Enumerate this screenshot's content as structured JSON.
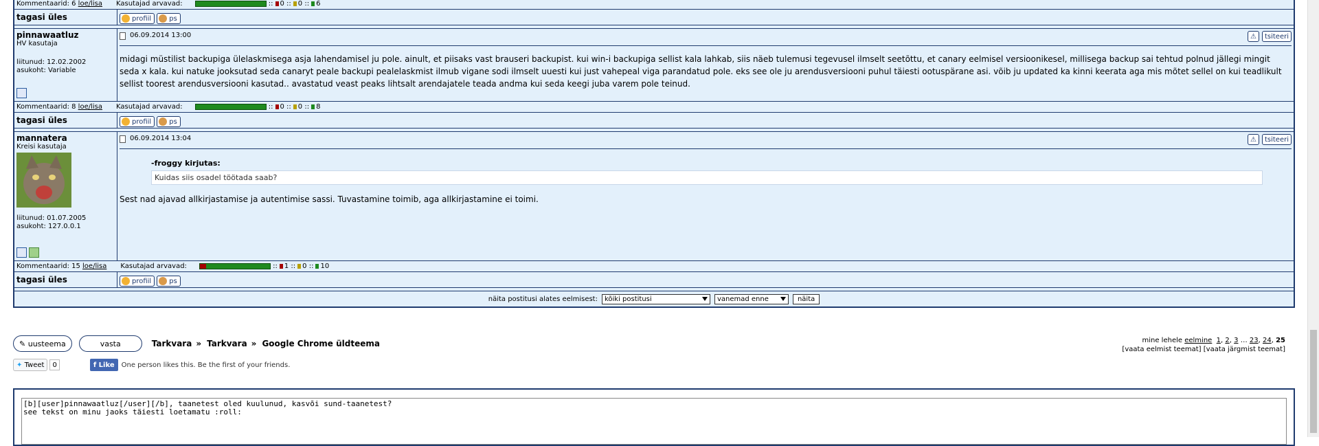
{
  "post1_meta": {
    "comments": "Kommentaarid: 6",
    "readlink": "loe/lisa",
    "users_label": "Kasutajad arvavad:",
    "neg": "0",
    "neutral": "0",
    "pos": "6"
  },
  "back_to_top": "tagasi üles",
  "buttons": {
    "profile": "profiil",
    "pm": "ps",
    "quote": "tsiteeri"
  },
  "post2": {
    "user": "pinnawaatluz",
    "title": "HV kasutaja",
    "joined": "liitunud: 12.02.2002",
    "location": "asukoht: Variable",
    "date": "06.09.2014 13:00",
    "text": "midagi müstilist backupiga ülelaskmisega asja lahendamisel ju pole. ainult, et piisaks vast brauseri backupist. kui win-i backupiga sellist kala lahkab, siis näeb tulemusi tegevusel ilmselt seetõttu, et canary eelmisel versioonikesel, millisega backup sai tehtud polnud jällegi mingit seda x kala. kui natuke jooksutad seda canaryt peale backupi pealelaskmist ilmub vigane sodi ilmselt uuesti kui just vahepeal viga parandatud pole. eks see ole ju arendusversiooni puhul täiesti ootuspärane asi. võib ju updated ka kinni keerata aga mis mõtet sellel on kui teadlikult sellist toorest arendusversiooni kasutad.. avastatud veast peaks lihtsalt arendajatele teada andma kui seda keegi juba varem pole teinud.",
    "comments": "Kommentaarid: 8",
    "readlink": "loe/lisa",
    "users_label": "Kasutajad arvavad:",
    "neg": "0",
    "neutral": "0",
    "pos": "8"
  },
  "post3": {
    "user": "mannatera",
    "title": "Kreisi kasutaja",
    "joined": "liitunud: 01.07.2005",
    "location": "asukoht: 127.0.0.1",
    "date": "06.09.2014 13:04",
    "quote_author": "-froggy kirjutas:",
    "quote_text": "Kuidas siis osadel töötada saab?",
    "text": "Sest nad ajavad allkirjastamise ja autentimise sassi. Tuvastamine toimib, aga allkirjastamine ei toimi.",
    "comments": "Kommentaarid: 15",
    "readlink": "loe/lisa",
    "users_label": "Kasutajad arvavad:",
    "neg": "1",
    "neutral": "0",
    "pos": "10"
  },
  "filter": {
    "label": "näita postitusi alates eelmisest:",
    "period": "kõiki postitusi",
    "order": "vanemad enne",
    "show": "näita"
  },
  "nav": {
    "new_topic": "uusteema",
    "reply": "vasta",
    "crumb1": "Tarkvara",
    "crumb2": "Tarkvara",
    "crumb3": "Google Chrome üldteema",
    "goto": "mine lehele",
    "prev": "eelmine",
    "p1": "1",
    "p2": "2",
    "p3": "3",
    "ellipsis": "…",
    "p23": "23",
    "p24": "24",
    "p25": "25",
    "prev_topic": "[vaata eelmist teemat]",
    "next_topic": "[vaata järgmist teemat]"
  },
  "social": {
    "tweet": "Tweet",
    "tweet_count": "0",
    "like": "Like",
    "like_text": "One person likes this. Be the first of your friends."
  },
  "editor": {
    "line1": "[b][user]pinnawaatluz[/user][/b], taanetest oled kuulunud, kasvõi sund-taanetest?",
    "line2": "see tekst on minu jaoks täiesti loetamatu :roll:"
  },
  "colors": {
    "border": "#1e3a6e",
    "bg": "#e3f0fb",
    "bar_pos": "#1f8a1f",
    "bar_neg": "#a50000"
  }
}
